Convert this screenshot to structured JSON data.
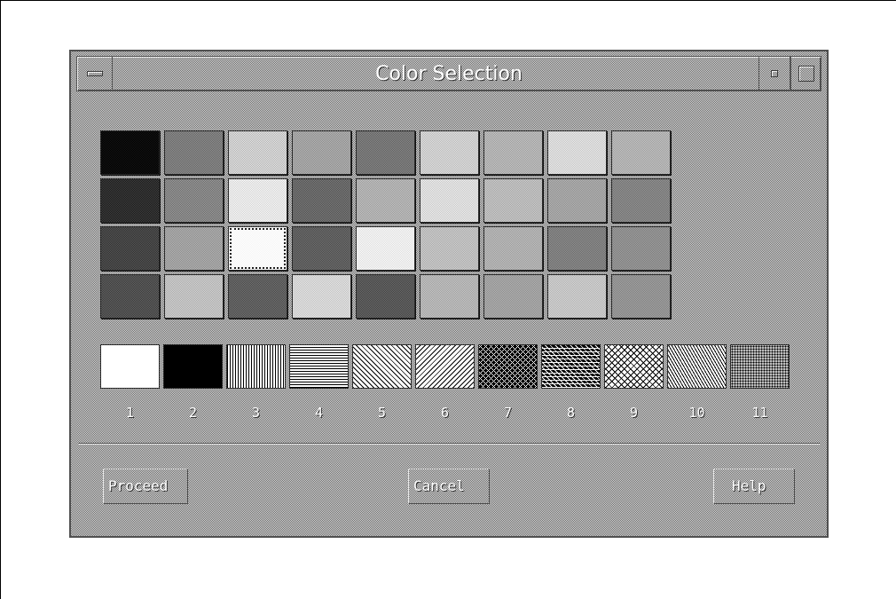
{
  "window": {
    "title": "Color Selection"
  },
  "swatches": [
    {
      "dark": "#000000",
      "light": "#151515"
    },
    {
      "dark": "#666666",
      "light": "#909090"
    },
    {
      "dark": "#b0b0b0",
      "light": "#e8e8e8"
    },
    {
      "dark": "#8a8a8a",
      "light": "#b8b8b8"
    },
    {
      "dark": "#606060",
      "light": "#8a8a8a"
    },
    {
      "dark": "#b8b8b8",
      "light": "#e2e2e2"
    },
    {
      "dark": "#9a9a9a",
      "light": "#c8c8c8"
    },
    {
      "dark": "#c4c4c4",
      "light": "#ececec"
    },
    {
      "dark": "#9c9c9c",
      "light": "#c6c6c6"
    },
    {
      "dark": "#1a1a1a",
      "light": "#404040"
    },
    {
      "dark": "#6a6a6a",
      "light": "#9e9e9e"
    },
    {
      "dark": "#d2d2d2",
      "light": "#fafafa"
    },
    {
      "dark": "#505050",
      "light": "#7e7e7e"
    },
    {
      "dark": "#9a9a9a",
      "light": "#c4c4c4"
    },
    {
      "dark": "#c6c6c6",
      "light": "#f0f0f0"
    },
    {
      "dark": "#a4a4a4",
      "light": "#cecece"
    },
    {
      "dark": "#8e8e8e",
      "light": "#b6b6b6"
    },
    {
      "dark": "#6e6e6e",
      "light": "#969696"
    },
    {
      "dark": "#303030",
      "light": "#585858"
    },
    {
      "dark": "#8a8a8a",
      "light": "#b6b6b6"
    },
    {
      "dark": "#f4f4f4",
      "light": "#ffffff"
    },
    {
      "dark": "#4a4a4a",
      "light": "#727272"
    },
    {
      "dark": "#dcdcdc",
      "light": "#fcfcfc"
    },
    {
      "dark": "#a8a8a8",
      "light": "#d2d2d2"
    },
    {
      "dark": "#9a9a9a",
      "light": "#c2c2c2"
    },
    {
      "dark": "#6a6a6a",
      "light": "#929292"
    },
    {
      "dark": "#7a7a7a",
      "light": "#a2a2a2"
    },
    {
      "dark": "#3a3a3a",
      "light": "#646464"
    },
    {
      "dark": "#aaaaaa",
      "light": "#d4d4d4"
    },
    {
      "dark": "#484848",
      "light": "#747474"
    },
    {
      "dark": "#c0c0c0",
      "light": "#e8e8e8"
    },
    {
      "dark": "#424242",
      "light": "#6c6c6c"
    },
    {
      "dark": "#9e9e9e",
      "light": "#c8c8c8"
    },
    {
      "dark": "#8c8c8c",
      "light": "#b4b4b4"
    },
    {
      "dark": "#b0b0b0",
      "light": "#d8d8d8"
    },
    {
      "dark": "#7e7e7e",
      "light": "#a6a6a6"
    }
  ],
  "selected_swatch": 20,
  "patterns": [
    {
      "number": "1",
      "kind": "solid-white"
    },
    {
      "number": "2",
      "kind": "solid-black"
    },
    {
      "number": "3",
      "kind": "vertical-lines"
    },
    {
      "number": "4",
      "kind": "horizontal-lines"
    },
    {
      "number": "5",
      "kind": "diagonal-up"
    },
    {
      "number": "6",
      "kind": "diagonal-down"
    },
    {
      "number": "7",
      "kind": "coarse-checker"
    },
    {
      "number": "8",
      "kind": "triangle-grid"
    },
    {
      "number": "9",
      "kind": "light-lattice"
    },
    {
      "number": "10",
      "kind": "fine-diagonal"
    },
    {
      "number": "11",
      "kind": "fine-dots"
    }
  ],
  "buttons": {
    "proceed": "Proceed",
    "cancel": "Cancel",
    "help": "Help"
  }
}
